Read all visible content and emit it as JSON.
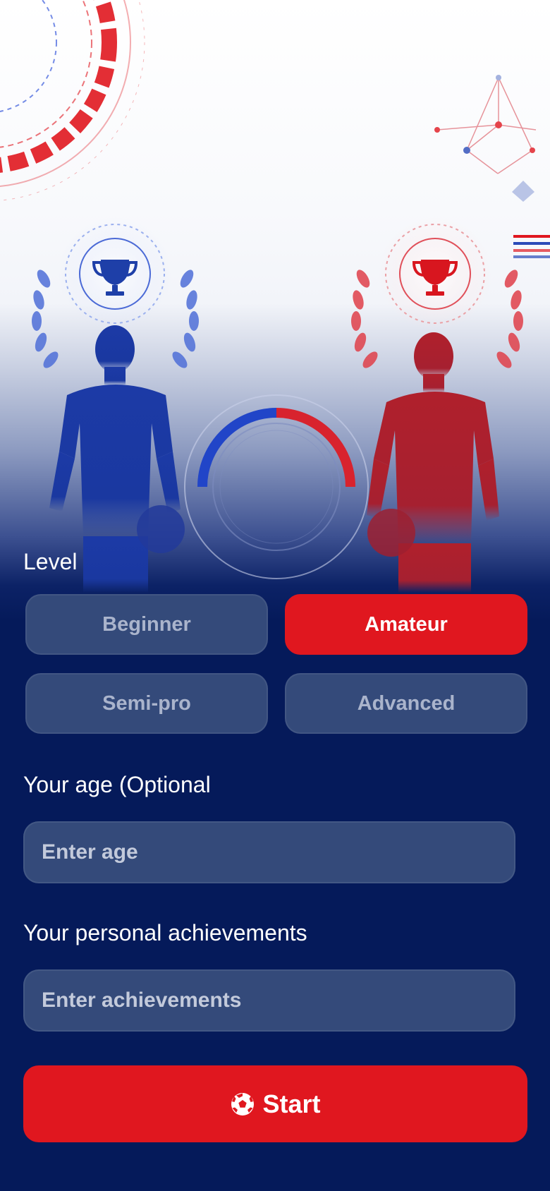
{
  "colors": {
    "background": "#051a5a",
    "field": "#344a7a",
    "accent_red": "#e0171f",
    "accent_blue": "#1e3fa8"
  },
  "hero": {
    "left_icon": "trophy-icon",
    "right_icon": "trophy-icon"
  },
  "level": {
    "label": "Level",
    "selected": "Amateur",
    "options": [
      {
        "label": "Beginner"
      },
      {
        "label": "Amateur"
      },
      {
        "label": "Semi-pro"
      },
      {
        "label": "Advanced"
      }
    ]
  },
  "age": {
    "label": "Your age (Optional",
    "value": "",
    "placeholder": "Enter age"
  },
  "achievements": {
    "label": "Your personal achievements",
    "value": "",
    "placeholder": "Enter achievements"
  },
  "start_button": {
    "label": "Start",
    "icon": "soccer-ball-icon"
  }
}
